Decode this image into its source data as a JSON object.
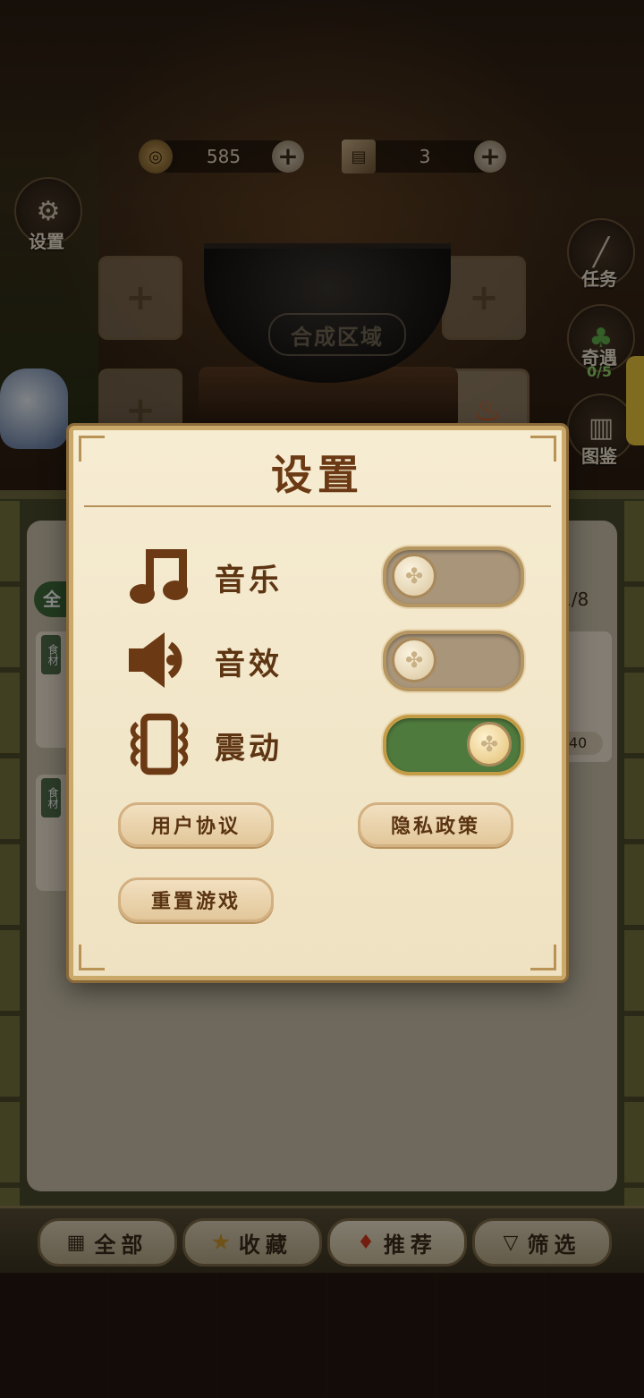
{
  "hud": {
    "coins": "585",
    "books": "3",
    "settings_label": "设置",
    "wok_label": "合成区域",
    "side": {
      "task": "任务",
      "encounter": "奇遇",
      "encounter_progress": "0/5",
      "catalog": "图鉴"
    }
  },
  "background_panel": {
    "tab_all_short": "全",
    "count": "1/8",
    "badge": "食材",
    "price": "40"
  },
  "settings": {
    "title": "设置",
    "rows": [
      {
        "label": "音乐",
        "icon": "music-note-icon",
        "on": false
      },
      {
        "label": "音效",
        "icon": "speaker-icon",
        "on": false
      },
      {
        "label": "震动",
        "icon": "vibration-icon",
        "on": true
      }
    ],
    "buttons": {
      "user_agreement": "用户协议",
      "privacy_policy": "隐私政策",
      "reset_game": "重置游戏"
    }
  },
  "bottom_nav": {
    "all": "全部",
    "favorites": "收藏",
    "recommended": "推荐",
    "filter": "筛选"
  },
  "colors": {
    "title_brown": "#6b3a14",
    "toggle_on": "#4f7a3e",
    "toggle_off": "#a9957a",
    "paper": "#f6ecd2"
  }
}
